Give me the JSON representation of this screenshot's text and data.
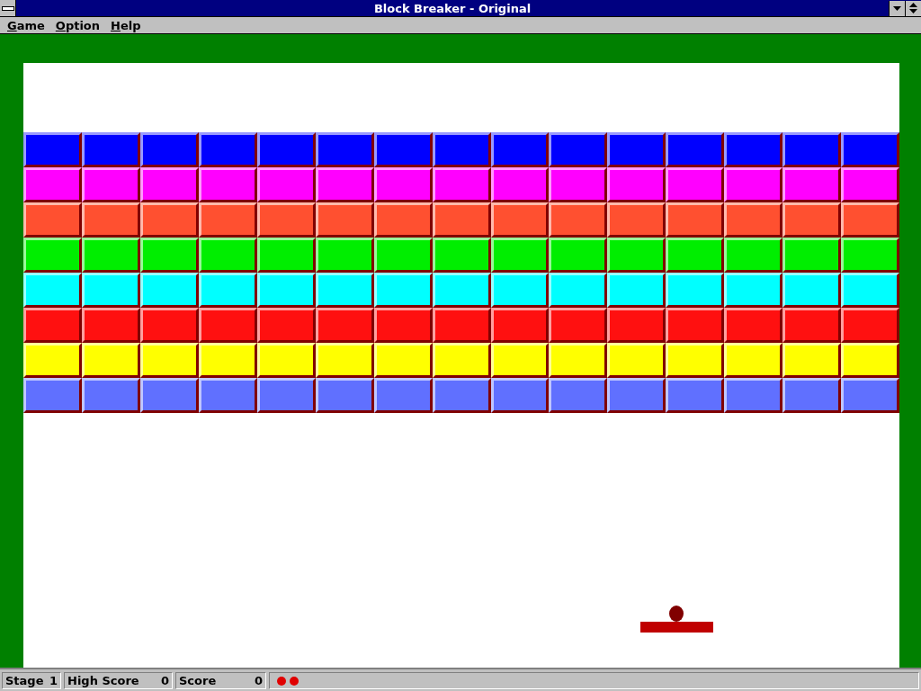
{
  "window": {
    "title": "Block Breaker - Original"
  },
  "menu": [
    {
      "label": "Game"
    },
    {
      "label": "Option"
    },
    {
      "label": "Help"
    }
  ],
  "brick_rows": [
    {
      "color": "#0000ff"
    },
    {
      "color": "#ff00ff"
    },
    {
      "color": "#ff5030"
    },
    {
      "color": "#00ee00"
    },
    {
      "color": "#00ffff"
    },
    {
      "color": "#ff1010"
    },
    {
      "color": "#ffff00"
    },
    {
      "color": "#6070ff"
    }
  ],
  "status_bar": {
    "stage_label": "Stage",
    "stage": "1",
    "high_score_label": "High Score",
    "high_score": "0",
    "score_label": "Score",
    "score": "0",
    "lives": [
      {
        "kind": "ball"
      },
      {
        "kind": "ball"
      }
    ]
  }
}
